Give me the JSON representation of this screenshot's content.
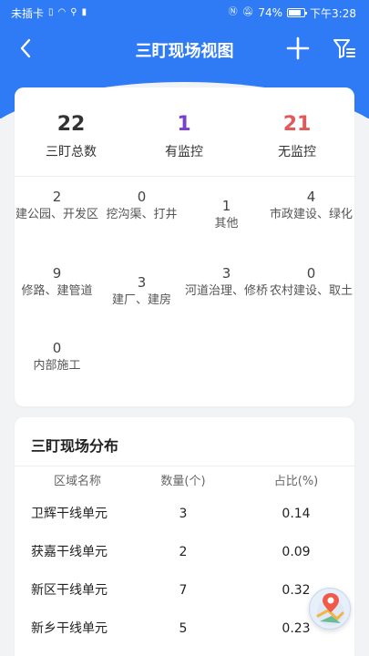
{
  "status_bar": {
    "carrier": "未插卡",
    "battery": "74%",
    "time": "下午3:28"
  },
  "nav": {
    "title": "三盯现场视图"
  },
  "summary": {
    "stats": [
      {
        "value": "22",
        "label": "三盯总数",
        "color": "#333333"
      },
      {
        "value": "1",
        "label": "有监控",
        "color": "#7a3fd0"
      },
      {
        "value": "21",
        "label": "无监控",
        "color": "#e05a5a"
      }
    ]
  },
  "categories": [
    {
      "count": "2",
      "name": "建公园、开发区"
    },
    {
      "count": "0",
      "name": "挖沟渠、打井"
    },
    {
      "count": "1",
      "name": "其他"
    },
    {
      "count": "4",
      "name": "市政建设、绿化"
    },
    {
      "count": "9",
      "name": "修路、建管道"
    },
    {
      "count": "3",
      "name": "建厂、建房"
    },
    {
      "count": "3",
      "name": "河道治理、修桥"
    },
    {
      "count": "0",
      "name": "农村建设、取土"
    },
    {
      "count": "0",
      "name": "内部施工"
    }
  ],
  "distribution": {
    "title": "三盯现场分布",
    "headers": [
      "区域名称",
      "数量(个)",
      "占比(%)"
    ],
    "rows": [
      {
        "region": "卫辉干线单元",
        "count": "3",
        "ratio": "0.14"
      },
      {
        "region": "获嘉干线单元",
        "count": "2",
        "ratio": "0.09"
      },
      {
        "region": "新区干线单元",
        "count": "7",
        "ratio": "0.32"
      },
      {
        "region": "新乡干线单元",
        "count": "5",
        "ratio": "0.23"
      }
    ]
  },
  "colors": {
    "primary": "#2f7bf5",
    "background": "#f2f3f5"
  },
  "icons": {
    "back": "back-arrow-icon",
    "add": "plus-icon",
    "filter": "filter-icon",
    "map": "map-location-icon"
  }
}
